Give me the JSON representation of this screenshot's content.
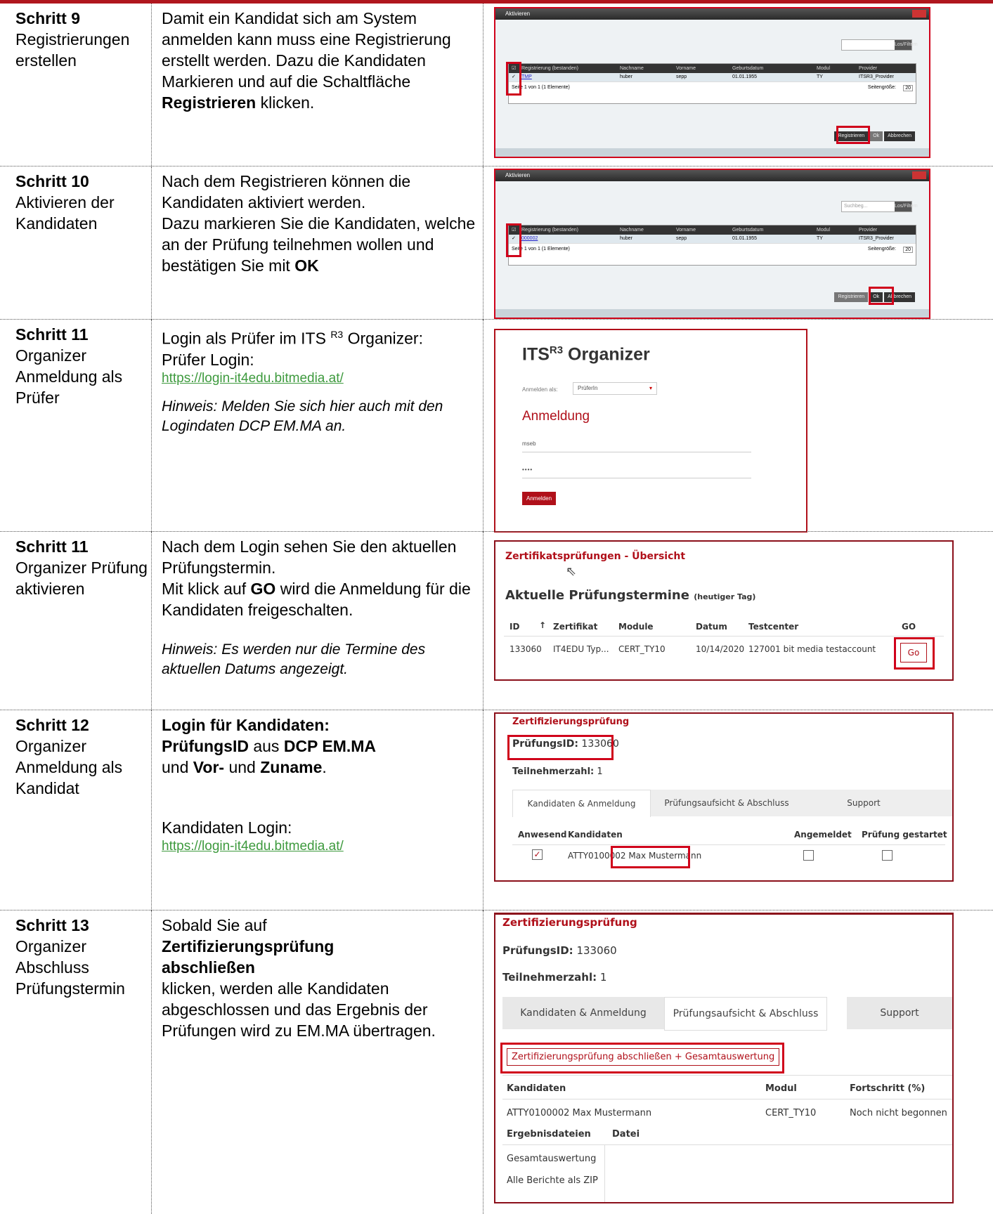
{
  "steps": [
    {
      "title": "Schritt 9",
      "sub": "Registrierungen erstellen",
      "desc_parts": [
        "Damit ein Kandidat sich am System anmelden kann muss eine Registrierung erstellt werden. Dazu die Kandidaten Markieren und auf die Schaltfläche ",
        "Registrieren",
        " klicken."
      ]
    },
    {
      "title": "Schritt 10",
      "sub": "Aktivieren der Kandidaten",
      "desc_parts": [
        "Nach dem Registrieren können die Kandidaten aktiviert werden.",
        "Dazu markieren Sie die Kandidaten, welche an der Prüfung teilnehmen wollen und bestätigen Sie mit ",
        "OK"
      ]
    },
    {
      "title": "Schritt 11",
      "sub": "Organizer Anmeldung als Prüfer",
      "desc": "Login als Prüfer im ITS ",
      "desc_sup": "R3",
      "desc_tail": " Organizer:",
      "desc2": "Prüfer Login:",
      "link": "https://login-it4edu.bitmedia.at/",
      "hint": "Hinweis: Melden Sie sich hier auch mit den Logindaten DCP EM.MA an."
    },
    {
      "title": "Schritt 11",
      "sub": "Organizer Prüfung aktivieren",
      "desc_parts": [
        "Nach dem Login sehen Sie den aktuellen Prüfungstermin.",
        "Mit klick auf ",
        "GO",
        " wird die Anmeldung für die Kandidaten freigeschalten."
      ],
      "hint": "Hinweis: Es werden nur die Termine des aktuellen Datums angezeigt."
    },
    {
      "title": "Schritt 12",
      "sub": "Organizer Anmeldung als Kandidat",
      "bold1": "Login für Kandidaten:",
      "bold2": "PrüfungsID",
      "t1": " aus ",
      "bold3": "DCP EM.MA",
      "t2": "und ",
      "bold4": "Vor-",
      "t3": " und ",
      "bold5": "Zuname",
      "t4": ".",
      "label": "Kandidaten Login:",
      "link": "https://login-it4edu.bitmedia.at/"
    },
    {
      "title": "Schritt 13",
      "sub": "Organizer Abschluss Prüfungstermin",
      "t1": "Sobald Sie auf",
      "bold1": "Zertifizierungsprüfung abschließen",
      "t2": "klicken, werden alle Kandidaten abgeschlossen und das Ergebnis der Prüfungen wird zu EM.MA übertragen."
    }
  ],
  "dialog": {
    "title": "Aktivieren",
    "search_btn": "Los/Filtern",
    "search_placeholder": "Suchbeg...",
    "cols": [
      "Registrierung (bestanden)",
      "Nachname",
      "Vorname",
      "Geburtsdatum",
      "Modul",
      "Provider"
    ],
    "row1": [
      "TMP",
      "huber",
      "sepp",
      "01.01.1955",
      "TY",
      "ITSR3_Provider"
    ],
    "row2": [
      "000002",
      "huber",
      "sepp",
      "01.01.1955",
      "TY",
      "ITSR3_Provider"
    ],
    "pager": "Seite 1 von 1 (1 Elemente)",
    "pagesize_label": "Seitengröße:",
    "pagesize": "20",
    "btn_register": "Registrieren",
    "btn_ok": "Ok",
    "btn_cancel": "Abbrechen"
  },
  "login": {
    "h": "ITS",
    "h_sup": "R3",
    "h_tail": " Organizer",
    "as_label": "Anmelden als:",
    "as_value": "PrüferIn",
    "title": "Anmeldung",
    "user": "mseb",
    "pass": "••••",
    "btn": "Anmelden"
  },
  "overview": {
    "title": "Zertifikatsprüfungen - Übersicht",
    "heading": "Aktuelle Prüfungstermine",
    "heading_small": "(heutiger Tag)",
    "cols": [
      "ID",
      "↑",
      "Zertifikat",
      "Module",
      "Datum",
      "Testcenter",
      "GO"
    ],
    "row": [
      "133060",
      "IT4EDU Typ...",
      "CERT_TY10",
      "10/14/2020",
      "127001 bit media testaccount"
    ],
    "go": "Go"
  },
  "exam1": {
    "title": "Zertifizierungsprüfung",
    "id_label": "PrüfungsID:",
    "id": "133060",
    "count_label": "Teilnehmerzahl:",
    "count": "1",
    "tabs": [
      "Kandidaten & Anmeldung",
      "Prüfungsaufsicht & Abschluss",
      "Support"
    ],
    "cols": [
      "Anwesend",
      "Kandidaten",
      "Angemeldet",
      "Prüfung gestartet"
    ],
    "cand_id": "ATTY0100002",
    "cand_name": "Max Mustermann",
    "check": "✓"
  },
  "exam2": {
    "title": "Zertifizierungsprüfung",
    "id_label": "PrüfungsID:",
    "id": "133060",
    "count_label": "Teilnehmerzahl:",
    "count": "1",
    "tabs": [
      "Kandidaten & Anmeldung",
      "Prüfungsaufsicht & Abschluss",
      "Support"
    ],
    "close_btn": "Zertifizierungsprüfung abschließen + Gesamtauswertung",
    "cols": [
      "Kandidaten",
      "Modul",
      "Fortschritt (%)"
    ],
    "row": [
      "ATTY0100002 Max Mustermann",
      "CERT_TY10",
      "Noch nicht begonnen"
    ],
    "files_cols": [
      "Ergebnisdateien",
      "Datei"
    ],
    "files": [
      "Gesamtauswertung",
      "Alle Berichte als ZIP"
    ]
  }
}
